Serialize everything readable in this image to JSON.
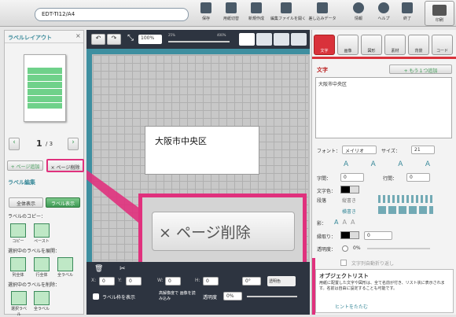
{
  "doc": {
    "name": "EDT-TI12/A4"
  },
  "toolbar": {
    "items": [
      "保存",
      "用紙切替",
      "新規作成",
      "編集ファイルを開く",
      "差し込みデータ",
      "情報",
      "ヘルプ",
      "終了"
    ],
    "print": "印刷"
  },
  "left": {
    "title": "ラベルレイアウト",
    "close": "×",
    "page_current": "1",
    "page_total": "/ 3",
    "add_page": "+ ページ追加",
    "delete_page": "× ページ削除",
    "edit_title": "ラベル編集",
    "show_all": "全体表示",
    "show_label": "ラベル表示",
    "copy_title": "ラベルのコピー：",
    "copy": "コピー",
    "paste": "ペースト",
    "expand_title": "選択中のラベルを展開：",
    "expand_items": [
      "列全体",
      "行全体",
      "全ラベル"
    ],
    "delete_title": "選択中のラベルを削除：",
    "delete_items": [
      "選択ラベル",
      "全ラベル"
    ]
  },
  "canvas": {
    "zoom": "100%",
    "zoom_min": "25%",
    "zoom_max": "400%",
    "text_box": "大阪市中央区",
    "callout": "× ページ削除",
    "coords": {
      "x_label": "X:",
      "x": "0",
      "y_label": "Y:",
      "y": "0",
      "w_label": "W:",
      "w": "0",
      "h_label": "H:",
      "h": "0",
      "unit": "mm",
      "angle": "0°"
    },
    "transparent_color": "透明色",
    "show_frame": "ラベル枠を表示",
    "hq_label": "高解像度で 画像を読み込み",
    "opacity_label": "透明度",
    "opacity": "0%"
  },
  "right": {
    "tabs": [
      "文字",
      "画像",
      "図形",
      "素材",
      "背景",
      "コード"
    ],
    "section_title": "文字",
    "add_one": "+ もう１つ追加",
    "text_value": "大阪市中央区",
    "font_label": "フォント：",
    "font_value": "メイリオ",
    "size_label": "サイズ：",
    "size_value": "21",
    "char_spacing_label": "字間：",
    "char_spacing": "0",
    "line_spacing_label": "行間：",
    "line_spacing": "0",
    "color_label": "文字色：",
    "para_label": "段落",
    "vertical": "縦書き",
    "horizontal": "横書き",
    "shadow_label": "影：",
    "outline_label": "縁取り：",
    "outline_value": "0",
    "opacity_label": "透明度：",
    "opacity_value": "0%",
    "autowrap": "文字列自動折り返し",
    "obj_title": "オブジェクトリスト",
    "obj_desc": "用紙に配置した文字や図形は、全て名前が付き、リスト状に表示されます。名前は自由に設定することも可能です。",
    "hint": "ヒントをたたむ"
  },
  "colors": {
    "accent_pink": "#e0317d",
    "teal": "#3a8a9a",
    "green": "#3e9a55",
    "canvas_dark": "#2d3440"
  }
}
